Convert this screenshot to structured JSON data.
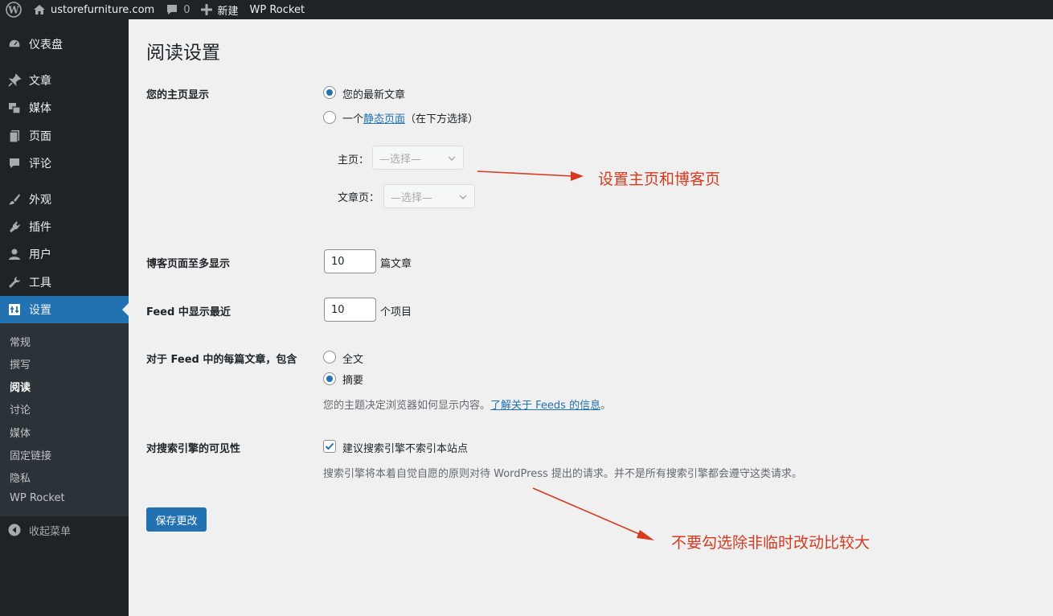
{
  "adminbar": {
    "site_name": "ustorefurniture.com",
    "comments_count": "0",
    "new_label": "新建",
    "plugin_label": "WP Rocket"
  },
  "sidebar": {
    "items": [
      {
        "label": "仪表盘",
        "icon": "dashboard-icon"
      },
      {
        "label": "文章",
        "icon": "pin-icon"
      },
      {
        "label": "媒体",
        "icon": "media-icon"
      },
      {
        "label": "页面",
        "icon": "page-icon"
      },
      {
        "label": "评论",
        "icon": "comment-icon"
      },
      {
        "label": "外观",
        "icon": "brush-icon"
      },
      {
        "label": "插件",
        "icon": "plugin-icon"
      },
      {
        "label": "用户",
        "icon": "user-icon"
      },
      {
        "label": "工具",
        "icon": "wrench-icon"
      },
      {
        "label": "设置",
        "icon": "settings-icon"
      }
    ],
    "submenu": [
      "常规",
      "撰写",
      "阅读",
      "讨论",
      "媒体",
      "固定链接",
      "隐私",
      "WP Rocket"
    ],
    "collapse_label": "收起菜单"
  },
  "page": {
    "title": "阅读设置",
    "homepage": {
      "label": "您的主页显示",
      "option_latest": "您的最新文章",
      "option_static_prefix": "一个",
      "option_static_link": "静态页面",
      "option_static_suffix": "（在下方选择）",
      "front_label": "主页：",
      "posts_label": "文章页：",
      "select_placeholder": "—选择—"
    },
    "blog_pages": {
      "label": "博客页面至多显示",
      "value": "10",
      "unit": "篇文章"
    },
    "feed_count": {
      "label": "Feed 中显示最近",
      "value": "10",
      "unit": "个项目"
    },
    "feed_content": {
      "label": "对于 Feed 中的每篇文章，包含",
      "option_full": "全文",
      "option_summary": "摘要",
      "desc_prefix": "您的主题决定浏览器如何显示内容。",
      "desc_link": "了解关于 Feeds 的信息",
      "desc_suffix": "。"
    },
    "search_visibility": {
      "label": "对搜索引擎的可见性",
      "checkbox_label": "建议搜索引擎不索引本站点",
      "desc": "搜索引擎将本着自觉自愿的原则对待 WordPress 提出的请求。并不是所有搜索引擎都会遵守这类请求。"
    },
    "save_label": "保存更改"
  },
  "annotations": {
    "note1": "设置主页和博客页",
    "note2": "不要勾选除非临时改动比较大",
    "color": "#d63a1f"
  }
}
